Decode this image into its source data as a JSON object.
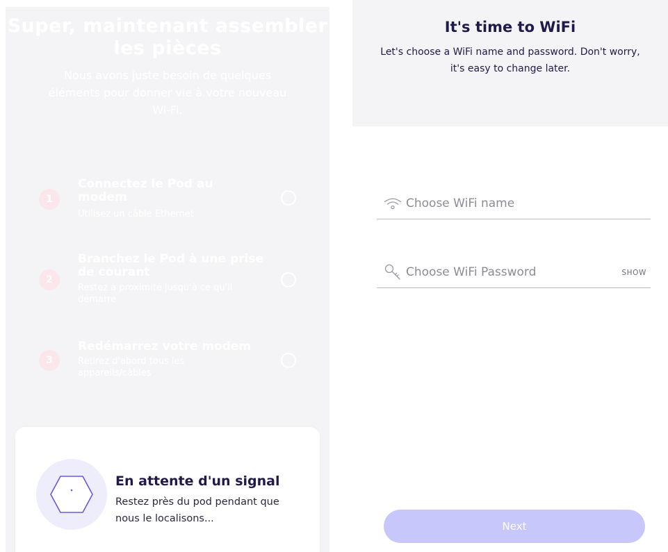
{
  "left": {
    "title": "Super, maintenant assembler les pièces",
    "subtitle": "Nous avons juste besoin de quelques éléments pour donner vie à votre nouveau Wi-Fi.",
    "steps": [
      {
        "num": "1",
        "title": "Connectez le Pod au modem",
        "desc": "Utilisez un câble Ethernet"
      },
      {
        "num": "2",
        "title": "Branchez le Pod à une prise de courant",
        "desc": "Restez à proximité jusqu'à ce qu'il démarre"
      },
      {
        "num": "3",
        "title": "Redémarrez votre modem",
        "desc": "Retirez d'abord tous les appareils/câbles"
      }
    ],
    "signal": {
      "title": "En attente d'un signal",
      "desc": "Restez près du pod pendant que nous le localisons..."
    }
  },
  "right": {
    "title": "It's time to WiFi",
    "subtitle": "Let's choose a WiFi name and password. Don't worry, it's easy to change later.",
    "wifi_name": {
      "placeholder": "Choose WiFi name",
      "value": "",
      "icon": "wifi-icon"
    },
    "wifi_password": {
      "placeholder": "Choose WiFi Password",
      "value": "",
      "icon": "key-icon",
      "toggle": "SHOW"
    },
    "next_label": "Next"
  },
  "colors": {
    "accent": "#c7c7fb",
    "title": "#1f1a4a",
    "panel": "#f4f4f6",
    "step_badge": "#fbe6ec",
    "pod_ring": "#eeedfb",
    "pod_outline": "#6a58d8"
  }
}
